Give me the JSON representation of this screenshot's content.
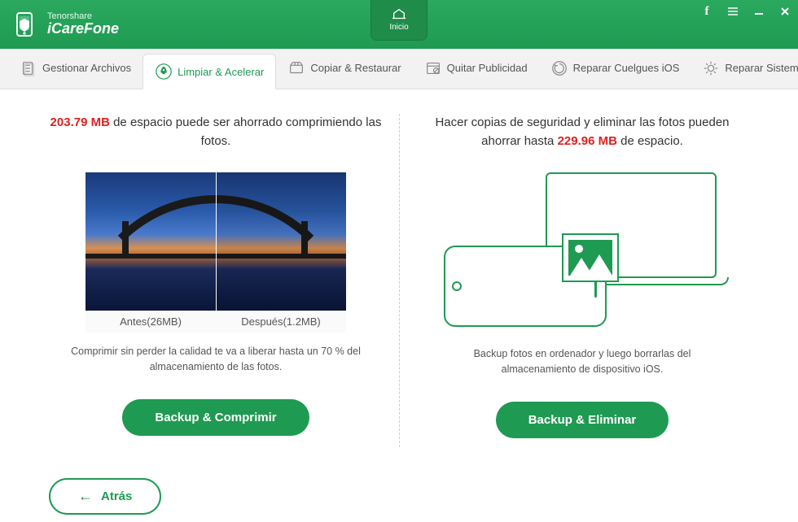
{
  "header": {
    "brand": "Tenorshare",
    "app": "iCareFone",
    "home_label": "Inicio"
  },
  "tabs": [
    {
      "label": "Gestionar Archivos",
      "icon": "files-icon"
    },
    {
      "label": "Limpiar & Acelerar",
      "icon": "rocket-icon",
      "active": true
    },
    {
      "label": "Copiar & Restaurar",
      "icon": "copy-icon"
    },
    {
      "label": "Quitar Publicidad",
      "icon": "ad-block-icon"
    },
    {
      "label": "Reparar Cuelgues iOS",
      "icon": "repair-ios-icon"
    },
    {
      "label": "Reparar Sistema Operativo",
      "icon": "repair-os-icon"
    }
  ],
  "left": {
    "highlight": "203.79 MB",
    "headline_rest": " de espacio puede ser ahorrado comprimiendo las fotos.",
    "before_label": "Antes(26MB)",
    "after_label": "Después(1.2MB)",
    "desc": "Comprimir sin perder la calidad te va a liberar hasta un 70 % del almacenamiento de las fotos.",
    "button": "Backup & Comprimir"
  },
  "right": {
    "headline_pre": "Hacer copias de seguridad y eliminar las fotos pueden ahorrar hasta ",
    "highlight": "229.96 MB",
    "headline_post": " de espacio.",
    "desc": "Backup fotos en ordenador y luego borrarlas del almacenamiento de dispositivo iOS.",
    "button": "Backup & Eliminar"
  },
  "footer": {
    "back": "Atrás"
  }
}
